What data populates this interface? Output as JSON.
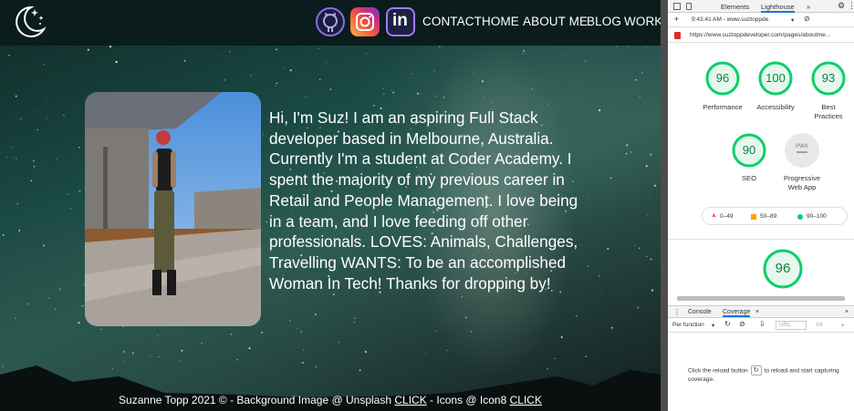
{
  "site": {
    "nav": {
      "links": [
        "CONTACT",
        "HOME",
        "ABOUT ME",
        "BLOG",
        "WORK"
      ],
      "icons": [
        "moon-stars-icon",
        "github-icon",
        "instagram-icon",
        "linkedin-icon"
      ],
      "linkedin_text": "in"
    },
    "bio": "Hi, I'm Suz! I am an aspiring Full Stack developer based in Melbourne, Australia. Currently I'm a student at Coder Academy. I spent the majority of my previous career in Retail and People Management. I love being in a team, and I love feeding off other professionals. LOVES: Animals, Challenges, Travelling WANTS: To be an accomplished Woman In Tech! Thanks for dropping by!",
    "footer": {
      "part1": "Suzanne Topp 2021 © - Background Image @ Unsplash ",
      "link1": "CLICK",
      "part2": " - Icons @ Icon8 ",
      "link2": "CLICK"
    }
  },
  "devtools": {
    "tabs": {
      "elements": "Elements",
      "lighthouse": "Lighthouse",
      "more": "»"
    },
    "report_time": "9:43:41 AM - www.suztoppde",
    "url": "https://www.suztoppdeveloper.com/pages/aboutme...",
    "scores": [
      {
        "label_line1": "Performance",
        "label_line2": "",
        "score": "96"
      },
      {
        "label_line1": "Accessibility",
        "label_line2": "",
        "score": "100"
      },
      {
        "label_line1": "Best",
        "label_line2": "Practices",
        "score": "93"
      },
      {
        "label_line1": "SEO",
        "label_line2": "",
        "score": "90"
      },
      {
        "label_line1": "Progressive",
        "label_line2": "Web App",
        "score": ""
      }
    ],
    "pwa_badge": "PWA",
    "legend": {
      "low": "0–49",
      "mid": "50–89",
      "high": "90–100"
    },
    "summary_score": "96",
    "drawer_tabs": {
      "console": "Console",
      "coverage": "Coverage"
    },
    "coverage_toolbar": {
      "per_function": "Per function",
      "url_placeholder": "URL",
      "all": "All"
    },
    "coverage_message_before": "Click the reload button",
    "coverage_message_after": "to reload and start capturing coverage.",
    "colors": {
      "pass": "#0cce6b",
      "pass_text": "#0b8043",
      "average": "#ffa400",
      "fail": "#ff4e42"
    }
  }
}
